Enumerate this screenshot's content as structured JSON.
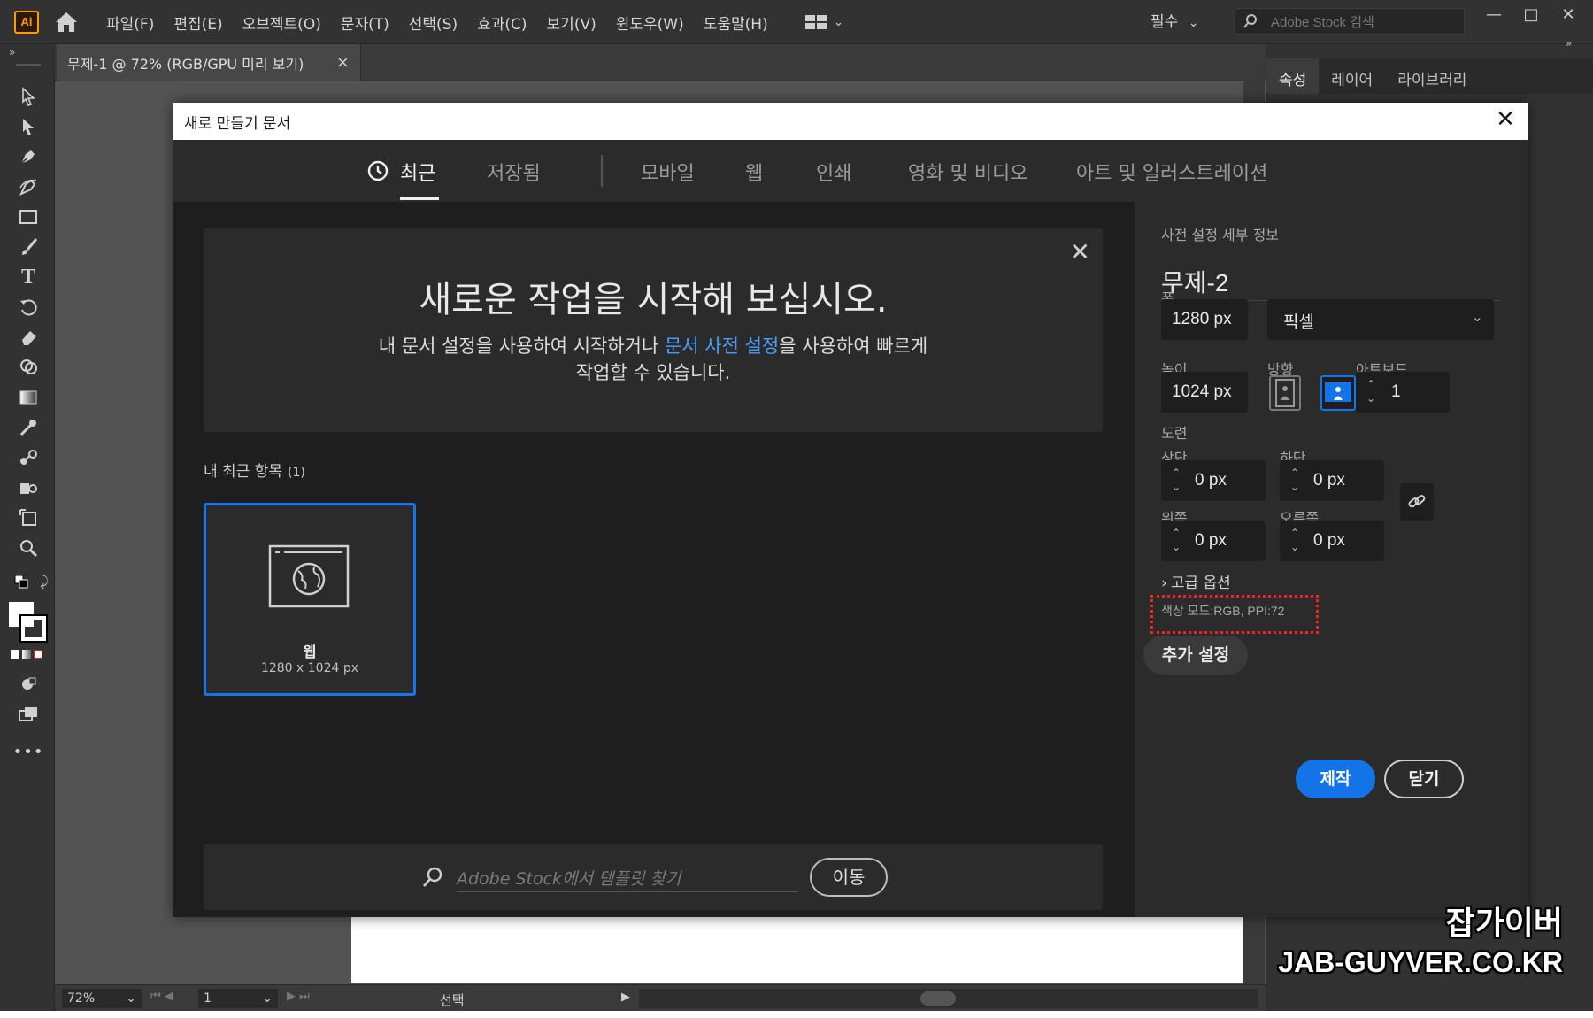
{
  "menubar": {
    "logo": "Ai",
    "items": [
      "파일(F)",
      "편집(E)",
      "오브젝트(O)",
      "문자(T)",
      "선택(S)",
      "효과(C)",
      "보기(V)",
      "윈도우(W)",
      "도움말(H)"
    ],
    "workspace": "필수",
    "stock_search_placeholder": "Adobe Stock 검색",
    "window_controls": [
      "—",
      "□",
      "✕"
    ]
  },
  "document_tab": {
    "title": "무제-1 @ 72% (RGB/GPU 미리 보기)",
    "close": "×"
  },
  "right_panel": {
    "tabs": [
      "속성",
      "레이어",
      "라이브러리"
    ]
  },
  "statusbar": {
    "zoom": "72%",
    "page": "1",
    "tool": "선택"
  },
  "dialog": {
    "title": "새로 만들기 문서",
    "close": "✕",
    "categories": [
      "최근",
      "저장됨",
      "모바일",
      "웹",
      "인쇄",
      "영화 및 비디오",
      "아트 및 일러스트레이션"
    ],
    "hero": {
      "title": "새로운 작업을 시작해 보십시오.",
      "line1_before": "내 문서 설정을 사용하여 시작하거나 ",
      "line1_link": "문서 사전 설정",
      "line1_after": "을 사용하여 빠르게",
      "line2": "작업할 수 있습니다.",
      "close": "✕"
    },
    "recent": {
      "label": "내 최근 항목",
      "count": "(1)",
      "card_name": "웹",
      "card_size": "1280 x 1024 px"
    },
    "search": {
      "placeholder": "Adobe Stock에서 템플릿 찾기",
      "go": "이동"
    },
    "details": {
      "heading": "사전 설정 세부 정보",
      "name": "무제-2",
      "width_label": "폭",
      "width": "1280 px",
      "unit": "픽셀",
      "height_label": "높이",
      "height": "1024 px",
      "orientation_label": "방향",
      "artboards_label": "아트보드",
      "artboards": "1",
      "bleed_label": "도련",
      "top_label": "상단",
      "top": "0 px",
      "bottom_label": "하단",
      "bottom": "0 px",
      "left_label": "왼쪽",
      "left": "0 px",
      "right_label": "오른쪽",
      "right": "0 px",
      "advanced": "고급 옵션",
      "color_mode": "색상 모드:RGB, PPI:72",
      "more_settings": "추가 설정",
      "create": "제작",
      "close": "닫기"
    }
  },
  "watermark": {
    "line1": "잡가이버",
    "line2": "JAB-GUYVER.CO.KR"
  },
  "colors": {
    "accent_blue": "#1473e6",
    "link_blue": "#4d9dff",
    "highlight_red": "#ff2020",
    "ai_orange": "#ff9a00"
  }
}
